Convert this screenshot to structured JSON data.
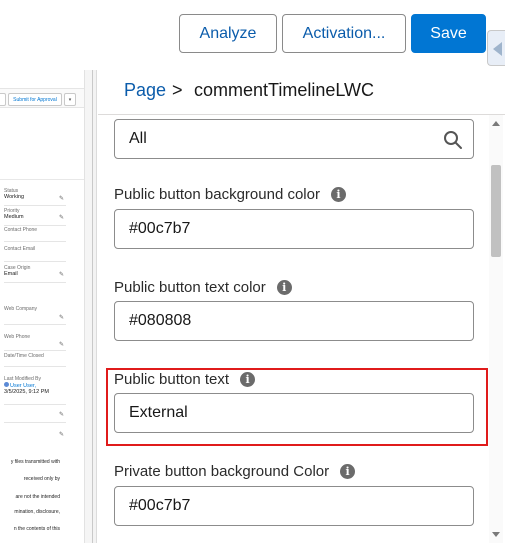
{
  "toolbar": {
    "analyze_label": "Analyze",
    "activation_label": "Activation...",
    "save_label": "Save"
  },
  "canvas": {
    "submit_label": "Submit for Approval",
    "fields": [
      {
        "label": "Status",
        "value": "Working"
      },
      {
        "label": "Priority",
        "value": "Medium"
      },
      {
        "label": "Contact Phone",
        "value": ""
      },
      {
        "label": "Contact Email",
        "value": ""
      },
      {
        "label": "Case Origin",
        "value": "Email"
      },
      {
        "label": "Web Company",
        "value": ""
      },
      {
        "label": "Web Phone",
        "value": ""
      },
      {
        "label": "Date/Time Closed",
        "value": ""
      },
      {
        "label": "Last Modified By",
        "value": "User User,"
      },
      {
        "label": "",
        "value": "3/5/2025, 9:12 PM"
      }
    ],
    "text_lines": [
      "y files transmitted with",
      "received only by",
      "are not the intended",
      "mination, disclosure,",
      "n the contents of this"
    ]
  },
  "panel": {
    "breadcrumb_parent": "Page",
    "breadcrumb_separator": ">",
    "breadcrumb_current": "commentTimelineLWC",
    "search_value": "All",
    "properties": [
      {
        "label": "Public button background color",
        "value": "#00c7b7"
      },
      {
        "label": "Public button text color",
        "value": "#080808"
      },
      {
        "label": "Public button text",
        "value": "External"
      },
      {
        "label": "Private button background Color",
        "value": "#00c7b7"
      }
    ],
    "info_glyph": "i"
  },
  "colors": {
    "brand": "#0176d3",
    "link": "#0b5cab",
    "highlight": "#e01b1b"
  }
}
